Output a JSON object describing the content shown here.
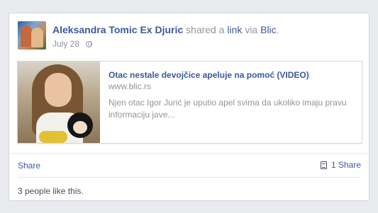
{
  "post": {
    "author": "Aleksandra Tomic Ex Djuric",
    "action_text": "shared a",
    "link_word": "link",
    "via_text": "via",
    "source": "Blic",
    "date": "July 28",
    "privacy_icon": "globe-icon"
  },
  "preview": {
    "title": "Otac nestale devojčice apeluje na pomoć (VIDEO)",
    "domain": "www.blic.rs",
    "description": "Njen otac Igor Jurić je uputio apel svima da ukoliko imaju pravu informaciju jave..."
  },
  "actions": {
    "share_label": "Share",
    "shares_count": "1 Share",
    "shares_icon": "doc-icon"
  },
  "likes": {
    "text": "3 people like this."
  },
  "colors": {
    "link": "#3b5998",
    "muted": "#90949c",
    "background": "#e9eaed"
  }
}
